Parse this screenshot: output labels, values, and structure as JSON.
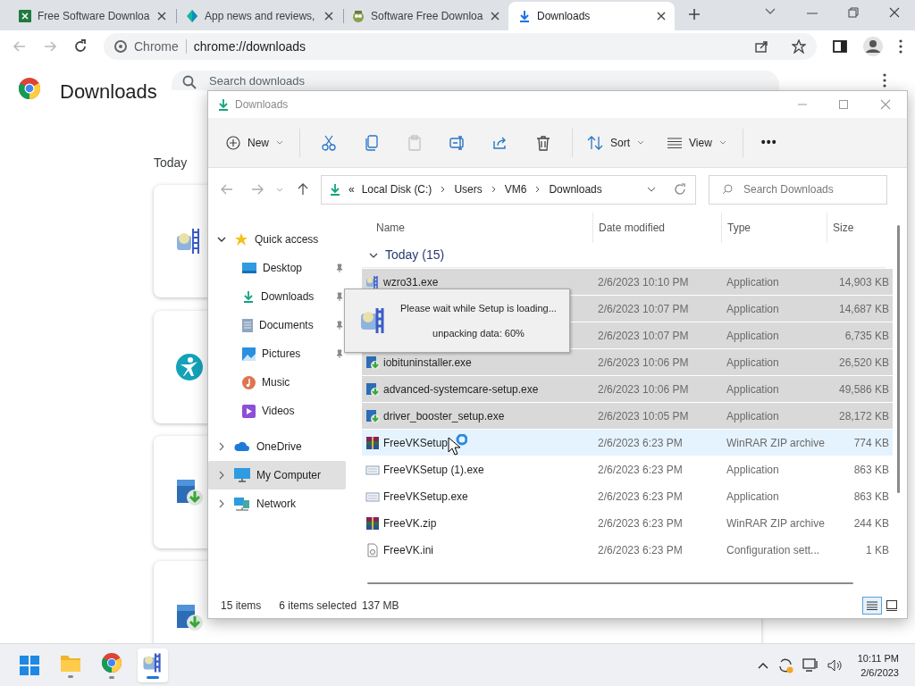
{
  "browser": {
    "tabs": [
      {
        "title": "Free Software Downloa",
        "selected": false
      },
      {
        "title": "App news and reviews,",
        "selected": false
      },
      {
        "title": "Software Free Downloa",
        "selected": false
      },
      {
        "title": "Downloads",
        "selected": true
      }
    ],
    "omnibox": {
      "chip": "Chrome",
      "url": "chrome://downloads"
    }
  },
  "downloads_page": {
    "title": "Downloads",
    "search_placeholder": "Search downloads",
    "section": "Today",
    "cards": [
      {
        "kind": "setup"
      },
      {
        "kind": "person"
      },
      {
        "kind": "iobit"
      },
      {
        "kind": "iobit"
      }
    ]
  },
  "explorer": {
    "title": "Downloads",
    "toolbar": [
      {
        "kind": "new",
        "label": "New",
        "disabled": false
      },
      {
        "kind": "cut",
        "disabled": false
      },
      {
        "kind": "copy",
        "disabled": false
      },
      {
        "kind": "paste",
        "disabled": true
      },
      {
        "kind": "rename",
        "disabled": false
      },
      {
        "kind": "share",
        "disabled": false
      },
      {
        "kind": "delete",
        "disabled": false
      },
      {
        "kind": "sort",
        "label": "Sort",
        "disabled": false
      },
      {
        "kind": "view",
        "label": "View",
        "disabled": false
      },
      {
        "kind": "more",
        "label": "•••",
        "disabled": false
      }
    ],
    "breadcrumb": {
      "overflow": "«",
      "parts": [
        "Local Disk (C:)",
        "Users",
        "VM6",
        "Downloads"
      ]
    },
    "search_placeholder": "Search Downloads",
    "nav": [
      {
        "label": "Quick access",
        "kind": "star",
        "expanded": true,
        "selected": false,
        "children": [
          {
            "label": "Desktop",
            "kind": "desktop",
            "pinned": true,
            "selected": false
          },
          {
            "label": "Downloads",
            "kind": "downloads",
            "pinned": true,
            "selected": false
          },
          {
            "label": "Documents",
            "kind": "documents",
            "pinned": true,
            "selected": false
          },
          {
            "label": "Pictures",
            "kind": "pictures",
            "pinned": true,
            "selected": false
          },
          {
            "label": "Music",
            "kind": "music",
            "pinned": false,
            "selected": false
          },
          {
            "label": "Videos",
            "kind": "videos",
            "pinned": false,
            "selected": false
          }
        ]
      },
      {
        "label": "OneDrive",
        "kind": "cloud",
        "expanded": false,
        "selected": false
      },
      {
        "label": "My Computer",
        "kind": "computer",
        "expanded": false,
        "selected": true
      },
      {
        "label": "Network",
        "kind": "network",
        "expanded": false,
        "selected": false
      }
    ],
    "columns": [
      "Name",
      "Date modified",
      "Type",
      "Size"
    ],
    "group": "Today (15)",
    "rows": [
      {
        "kind": "setup",
        "name": "wzro31.exe",
        "date": "2/6/2023 10:10 PM",
        "type": "Application",
        "size": "14,903 KB",
        "selected": true,
        "hover": false
      },
      {
        "date": "2/6/2023 10:07 PM",
        "type": "Application",
        "size": "14,687 KB",
        "selected": true,
        "hover": false
      },
      {
        "date": "2/6/2023 10:07 PM",
        "type": "Application",
        "size": "6,735 KB",
        "selected": true,
        "hover": false
      },
      {
        "kind": "iobit",
        "name": "iobituninstaller.exe",
        "date": "2/6/2023 10:06 PM",
        "type": "Application",
        "size": "26,520 KB",
        "selected": true,
        "hover": false
      },
      {
        "kind": "iobit",
        "name": "advanced-systemcare-setup.exe",
        "date": "2/6/2023 10:06 PM",
        "type": "Application",
        "size": "49,586 KB",
        "selected": true,
        "hover": false
      },
      {
        "kind": "iobit",
        "name": "driver_booster_setup.exe",
        "date": "2/6/2023 10:05 PM",
        "type": "Application",
        "size": "28,172 KB",
        "selected": true,
        "hover": false
      },
      {
        "kind": "rar",
        "name": "FreeVKSetup",
        "date": "2/6/2023 6:23 PM",
        "type": "WinRAR ZIP archive",
        "size": "774 KB",
        "selected": false,
        "hover": true
      },
      {
        "kind": "exe",
        "name": "FreeVKSetup (1).exe",
        "date": "2/6/2023 6:23 PM",
        "type": "Application",
        "size": "863 KB",
        "selected": false,
        "hover": false
      },
      {
        "kind": "exe",
        "name": "FreeVKSetup.exe",
        "date": "2/6/2023 6:23 PM",
        "type": "Application",
        "size": "863 KB",
        "selected": false,
        "hover": false
      },
      {
        "kind": "rar",
        "name": "FreeVK.zip",
        "date": "2/6/2023 6:23 PM",
        "type": "WinRAR ZIP archive",
        "size": "244 KB",
        "selected": false,
        "hover": false
      },
      {
        "kind": "ini",
        "name": "FreeVK.ini",
        "date": "2/6/2023 6:23 PM",
        "type": "Configuration sett...",
        "size": "1 KB",
        "selected": false,
        "hover": false
      }
    ],
    "status": {
      "count": "15 items",
      "selected": "6 items selected",
      "size": "137 MB"
    }
  },
  "setup_dialog": {
    "message": "Please wait while Setup is loading...",
    "progress": "unpacking data: 60%"
  },
  "taskbar": {
    "apps": [
      {
        "kind": "start",
        "active": false
      },
      {
        "kind": "folder",
        "active": false,
        "running": true
      },
      {
        "kind": "chrome",
        "active": false,
        "running": true
      },
      {
        "kind": "setup",
        "active": true,
        "running": true
      }
    ],
    "clock": {
      "time": "10:11 PM",
      "date": "2/6/2023"
    }
  }
}
